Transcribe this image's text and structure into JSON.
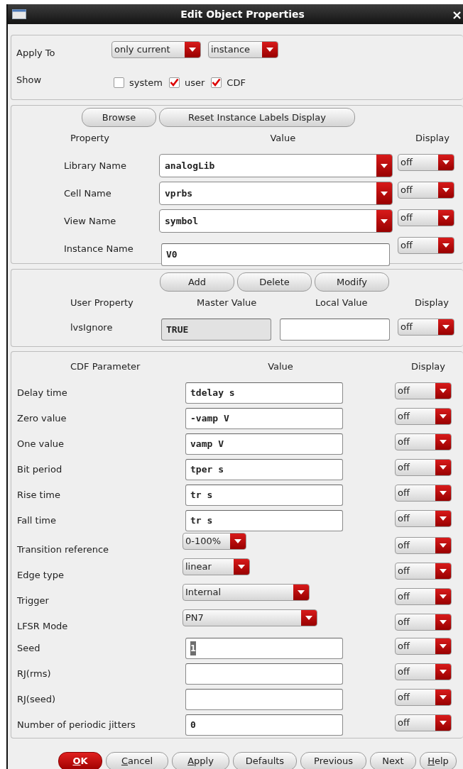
{
  "window": {
    "title": "Edit Object Properties",
    "close": "×"
  },
  "apply_to": {
    "label": "Apply To",
    "dropdowns": [
      "only current",
      "instance"
    ]
  },
  "show": {
    "label": "Show",
    "options": [
      {
        "label": "system",
        "checked": false
      },
      {
        "label": "user",
        "checked": true
      },
      {
        "label": "CDF",
        "checked": true
      }
    ]
  },
  "property_panel": {
    "buttons": [
      "Browse",
      "Reset Instance Labels Display"
    ],
    "columns": [
      "Property",
      "Value",
      "Display"
    ],
    "rows": [
      {
        "label": "Library Name",
        "kind": "combo",
        "value": "analogLib",
        "display": "off"
      },
      {
        "label": "Cell Name",
        "kind": "combo",
        "value": "vprbs",
        "display": "off"
      },
      {
        "label": "View Name",
        "kind": "combo",
        "value": "symbol",
        "display": "off"
      },
      {
        "label": "Instance Name",
        "kind": "field",
        "value": "V0",
        "display": "off"
      }
    ]
  },
  "user_panel": {
    "buttons": [
      "Add",
      "Delete",
      "Modify"
    ],
    "columns": [
      "User Property",
      "Master Value",
      "Local Value",
      "Display"
    ],
    "rows": [
      {
        "label": "lvsIgnore",
        "master_value": "TRUE",
        "display": "off"
      }
    ]
  },
  "cdf_panel": {
    "columns": [
      "CDF Parameter",
      "Value",
      "Display"
    ],
    "rows": [
      {
        "label": "Delay time",
        "kind": "field",
        "value": "tdelay s",
        "text_selected": false,
        "display": "off"
      },
      {
        "label": "Zero value",
        "kind": "field",
        "value": "-vamp V",
        "text_selected": false,
        "display": "off"
      },
      {
        "label": "One value",
        "kind": "field",
        "value": "vamp V",
        "text_selected": false,
        "display": "off"
      },
      {
        "label": "Bit period",
        "kind": "field",
        "value": "tper s",
        "text_selected": false,
        "display": "off"
      },
      {
        "label": "Rise time",
        "kind": "field",
        "value": "tr s",
        "text_selected": false,
        "display": "off"
      },
      {
        "label": "Fall time",
        "kind": "field",
        "value": "tr s",
        "text_selected": false,
        "display": "off"
      },
      {
        "label": "Transition reference",
        "kind": "choice",
        "value": "0-100%",
        "display": "off"
      },
      {
        "label": "Edge type",
        "kind": "choice",
        "value": "linear",
        "display": "off"
      },
      {
        "label": "Trigger",
        "kind": "choice",
        "value": "Internal",
        "display": "off"
      },
      {
        "label": "LFSR Mode",
        "kind": "choice",
        "value": "PN7",
        "display": "off"
      },
      {
        "label": "Seed",
        "kind": "field",
        "value": "1",
        "text_selected": true,
        "display": "off"
      },
      {
        "label": "RJ(rms)",
        "kind": "field",
        "display": "off"
      },
      {
        "label": "RJ(seed)",
        "kind": "field",
        "display": "off"
      },
      {
        "label": "Number of periodic jitters",
        "kind": "field",
        "value": "0",
        "text_selected": false,
        "display": "off"
      }
    ]
  },
  "buttons": [
    {
      "label": "OK",
      "kind": "default",
      "mnemonic": true
    },
    {
      "label": "Cancel",
      "kind": "normal",
      "mnemonic": true
    },
    {
      "label": "Apply",
      "kind": "normal",
      "mnemonic": true
    },
    {
      "label": "Defaults",
      "kind": "normal",
      "mnemonic": false
    },
    {
      "label": "Previous",
      "kind": "normal",
      "mnemonic": false
    },
    {
      "label": "Next",
      "kind": "normal",
      "mnemonic": false
    },
    {
      "label": "Help",
      "kind": "normal",
      "mnemonic": true
    }
  ]
}
